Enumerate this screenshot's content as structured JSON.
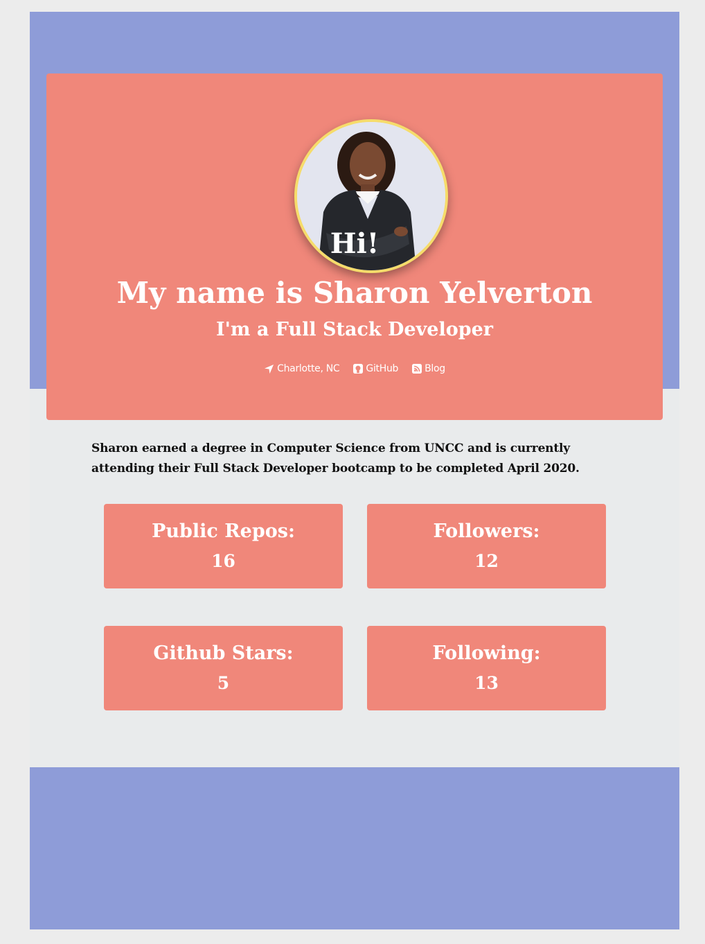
{
  "hero": {
    "greeting": "Hi!",
    "name_line": "My name is Sharon Yelverton",
    "role": "I'm a Full Stack Developer",
    "links": [
      {
        "label": "Charlotte, NC",
        "icon": "location-arrow-icon"
      },
      {
        "label": "GitHub",
        "icon": "github-square-icon"
      },
      {
        "label": "Blog",
        "icon": "rss-square-icon"
      }
    ]
  },
  "bio": "Sharon earned a degree in Computer Science from UNCC and is currently attending their Full Stack Developer bootcamp to be completed April 2020.",
  "stats": [
    {
      "label": "Public Repos:",
      "value": "16"
    },
    {
      "label": "Followers:",
      "value": "12"
    },
    {
      "label": "Github Stars:",
      "value": "5"
    },
    {
      "label": "Following:",
      "value": "13"
    }
  ],
  "colors": {
    "band": "#8e9cd8",
    "card": "#f0877a",
    "avatar_ring": "#f6dc6b",
    "background": "#e9ebec"
  }
}
